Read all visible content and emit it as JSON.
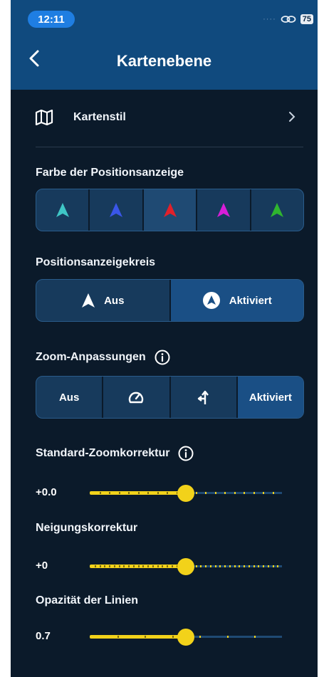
{
  "status": {
    "time": "12:11",
    "battery": "75"
  },
  "header": {
    "title": "Kartenebene"
  },
  "map_style": {
    "label": "Kartenstil"
  },
  "position_color": {
    "label": "Farbe der Positionsanzeige",
    "colors": [
      "#3fc6c6",
      "#3a56e8",
      "#e2202a",
      "#d81ed8",
      "#2fb52f"
    ],
    "selected_index": 2
  },
  "position_circle": {
    "label": "Positionsanzeigekreis",
    "options": [
      "Aus",
      "Aktiviert"
    ],
    "selected": "Aktiviert"
  },
  "zoom_adjust": {
    "label": "Zoom-Anpassungen",
    "options": [
      "Aus",
      "speedometer-icon",
      "turn-icon",
      "Aktiviert"
    ],
    "off_label": "Aus",
    "on_label": "Aktiviert",
    "selected": "Aktiviert"
  },
  "standard_zoom": {
    "label": "Standard-Zoomkorrektur",
    "value": "+0.0",
    "fraction": 0.5
  },
  "tilt": {
    "label": "Neigungskorrektur",
    "value": "+0",
    "fraction": 0.5
  },
  "line_opacity": {
    "label": "Opazität der Linien",
    "value": "0.7",
    "fraction": 0.5
  },
  "accent": "#f2d21a"
}
